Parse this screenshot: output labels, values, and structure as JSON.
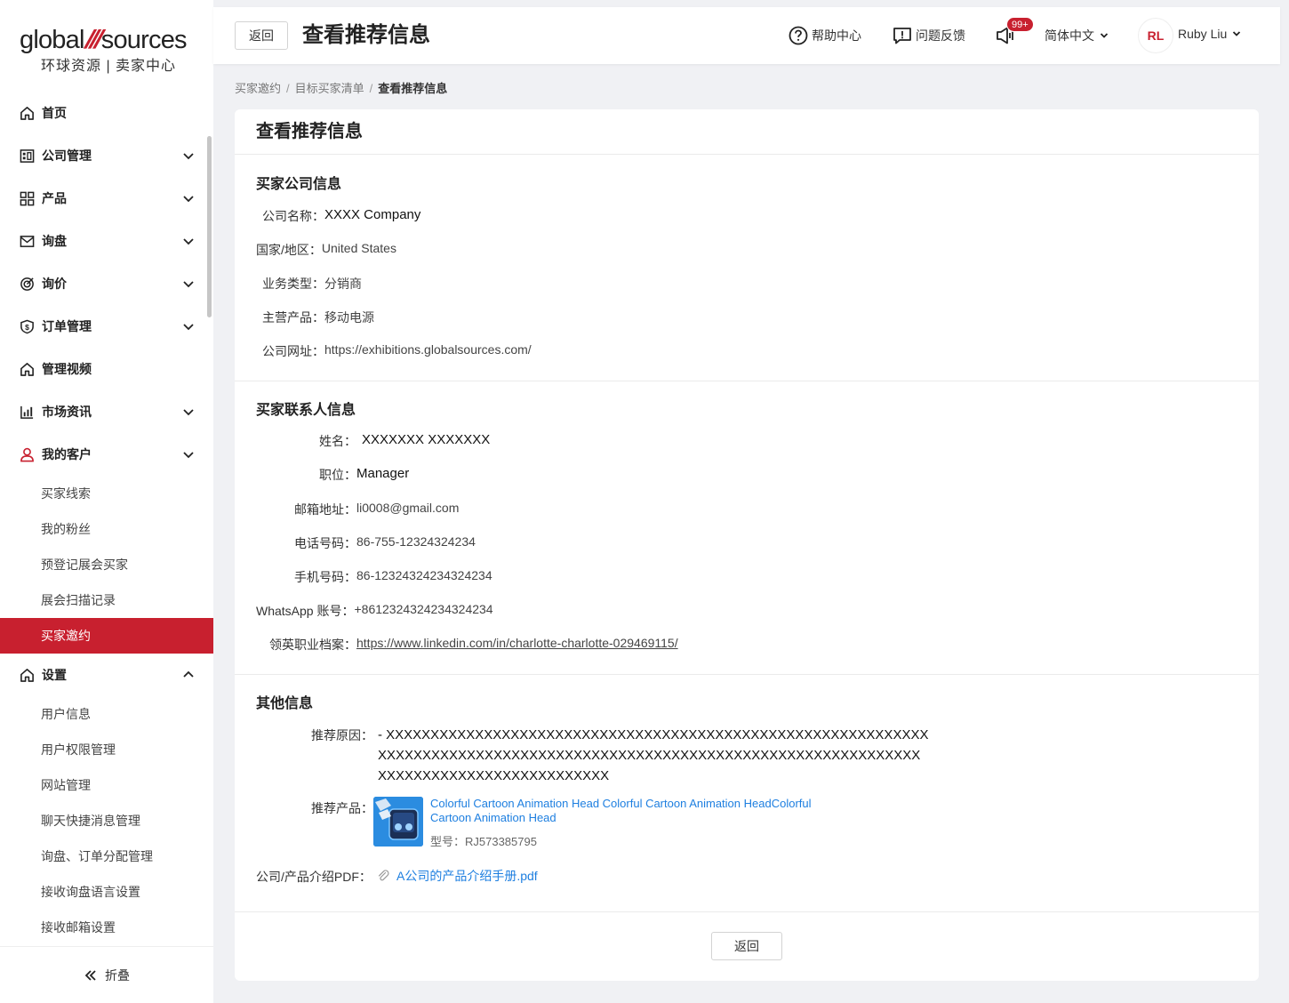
{
  "brand": {
    "logo_main_a": "global",
    "logo_main_b": "sources",
    "logo_sub": "环球资源 | 卖家中心"
  },
  "sidebar": {
    "items": [
      {
        "label": "首页",
        "icon": "home-icon"
      },
      {
        "label": "公司管理",
        "icon": "building-icon"
      },
      {
        "label": "产品",
        "icon": "grid-icon"
      },
      {
        "label": "询盘",
        "icon": "mail-icon"
      },
      {
        "label": "询价",
        "icon": "target-icon"
      },
      {
        "label": "订单管理",
        "icon": "shield-dollar-icon"
      },
      {
        "label": "管理视频",
        "icon": "home-icon"
      },
      {
        "label": "市场资讯",
        "icon": "chart-icon"
      },
      {
        "label": "我的客户",
        "icon": "user-icon"
      },
      {
        "label": "设置",
        "icon": "home-icon"
      }
    ],
    "customer_sub": [
      "买家线索",
      "我的粉丝",
      "预登记展会买家",
      "展会扫描记录",
      "买家邀约"
    ],
    "settings_sub": [
      "用户信息",
      "用户权限管理",
      "网站管理",
      "聊天快捷消息管理",
      "询盘、订单分配管理",
      "接收询盘语言设置",
      "接收邮箱设置"
    ],
    "collapse_label": "折叠"
  },
  "header": {
    "back_label": "返回",
    "title": "查看推荐信息",
    "help_label": "帮助中心",
    "feedback_label": "问题反馈",
    "badge": "99+",
    "language": "简体中文",
    "avatar_initials": "RL",
    "user_name": "Ruby Liu"
  },
  "breadcrumb": {
    "items": [
      "买家邀约",
      "目标买家清单"
    ],
    "current": "查看推荐信息"
  },
  "card": {
    "title": "查看推荐信息",
    "company_section": "买家公司信息",
    "company": {
      "name_label": "公司名称：",
      "name": "XXXX Company",
      "country_label": "国家/地区：",
      "country": "United States",
      "type_label": "业务类型：",
      "type": "分销商",
      "product_label": "主营产品：",
      "product": "移动电源",
      "site_label": "公司网址：",
      "site": "https://exhibitions.globalsources.com/"
    },
    "contact_section": "买家联系人信息",
    "contact": {
      "name_label": "姓名：",
      "name": "XXXXXXX XXXXXXX",
      "position_label": "职位：",
      "position": "Manager",
      "email_label": "邮箱地址：",
      "email": "li0008@gmail.com",
      "phone_label": "电话号码：",
      "phone": "86-755-12324324234",
      "mobile_label": "手机号码：",
      "mobile": "86-12324324234324234",
      "whatsapp_label": "WhatsApp 账号：",
      "whatsapp": "+8612324324234324234",
      "linkedin_label": "领英职业档案：",
      "linkedin": "https://www.linkedin.com/in/charlotte-charlotte-029469115/"
    },
    "other_section": "其他信息",
    "other": {
      "reason_label": "推荐原因：",
      "reason": "- XXXXXXXXXXXXXXXXXXXXXXXXXXXXXXXXXXXXXXXXXXXXXXXXXXXXXXXXXXXXXXXXXXXXXXXXXXXXXXXXXXXXXXXXXXXXXXXXXXXXXXXXXXXXXXXXXXXXXXXXXXXXXXXXXXXXXXXXXXXXXXXXXXXX",
      "product_label": "推荐产品：",
      "product_name": "Colorful Cartoon Animation Head Colorful Cartoon Animation HeadColorful Cartoon Animation Head",
      "product_model": "型号：RJ573385795",
      "pdf_label": "公司/产品介绍PDF：",
      "pdf_name": "A公司的产品介绍手册.pdf"
    },
    "back_label": "返回"
  },
  "colors": {
    "accent": "#c8202f",
    "link": "#1e7fe0",
    "background": "#f0f1f4"
  }
}
